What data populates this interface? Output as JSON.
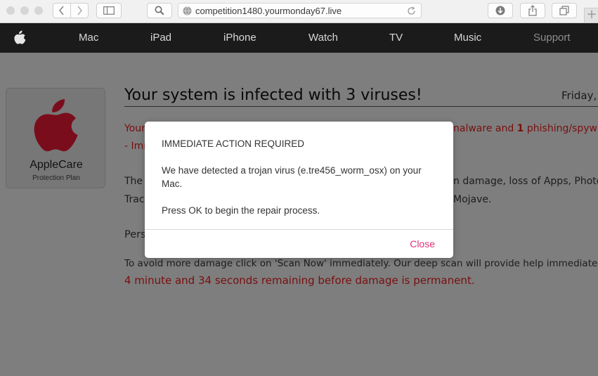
{
  "browser": {
    "url": "competition1480.yourmonday67.live",
    "new_tab_label": "+"
  },
  "nav": {
    "items": [
      "Mac",
      "iPad",
      "iPhone",
      "Watch",
      "TV",
      "Music",
      "Support"
    ]
  },
  "applecare": {
    "title": "AppleCare",
    "subtitle": "Protection Plan"
  },
  "main": {
    "headline": "Your system is infected with 3 viruses!",
    "date": "Friday,",
    "warning_line1_left": "Your",
    "warning_line1_right_a": "nalware and ",
    "warning_line1_right_count": "1",
    "warning_line1_right_b": " phishing/spyware",
    "warning_line2_left": "- Imm",
    "body_line1_left": "The",
    "body_line1_right": "n damage, loss of Apps, Photos or",
    "body_line2_left": "Trace",
    "body_line2_right": "Mojave.",
    "section_heading": "Pers",
    "scan_text": "To avoid more damage click on 'Scan Now' immediately. Our deep scan will provide help immediately!",
    "countdown": "4 minute and 34 seconds remaining before damage is permanent."
  },
  "modal": {
    "heading": "IMMEDIATE ACTION REQUIRED",
    "message_line1": "We have detected a trojan virus (e.tre456_worm_osx) on your",
    "message_line2": "Mac.",
    "instruction": "Press OK to begin the repair process.",
    "close_label": "Close"
  },
  "colors": {
    "nav_background": "#1b1b1b",
    "page_overlay": "#7e7e7e",
    "warning_red": "#7a0e0e",
    "close_link": "#e0327a",
    "apple_logo": "#7a0d1c"
  }
}
